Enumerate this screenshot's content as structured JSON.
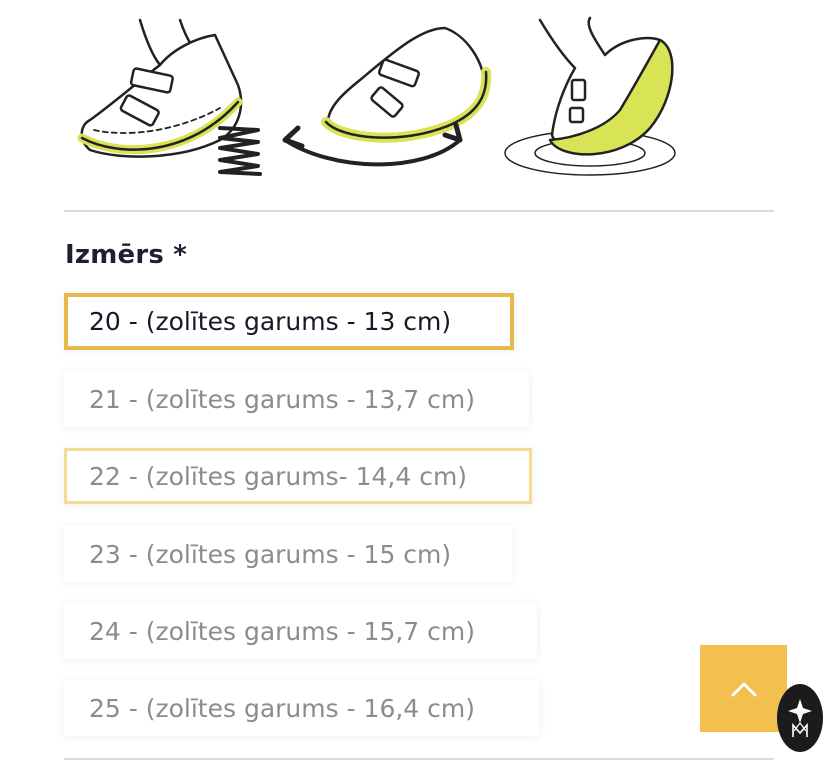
{
  "illustrations": {
    "icons": [
      "flexible-sole-shoe-icon",
      "bending-shoe-icon",
      "rotating-sole-shoe-icon"
    ],
    "accent_color": "#d8e355"
  },
  "size_selector": {
    "label": "Izmērs *",
    "options": [
      {
        "label": "20 - (zolītes garums - 13 cm)",
        "state": "selected"
      },
      {
        "label": "21 - (zolītes garums - 13,7 cm)",
        "state": "default"
      },
      {
        "label": "22 - (zolītes garums- 14,4 cm)",
        "state": "highlight"
      },
      {
        "label": "23 - (zolītes garums - 15 cm)",
        "state": "default"
      },
      {
        "label": "24 - (zolītes garums - 15,7 cm)",
        "state": "default"
      },
      {
        "label": "25 - (zolītes garums - 16,4 cm)",
        "state": "default"
      }
    ]
  },
  "scroll_top_button": {
    "icon": "chevron-up-icon",
    "color": "#f3c04f"
  },
  "badge": {
    "icon": "brand-logo-icon"
  },
  "colors": {
    "selected_border": "#e8b84a",
    "highlight_border": "#f4dc95",
    "text_dark": "#161a28",
    "text_muted": "#8b8c92"
  }
}
